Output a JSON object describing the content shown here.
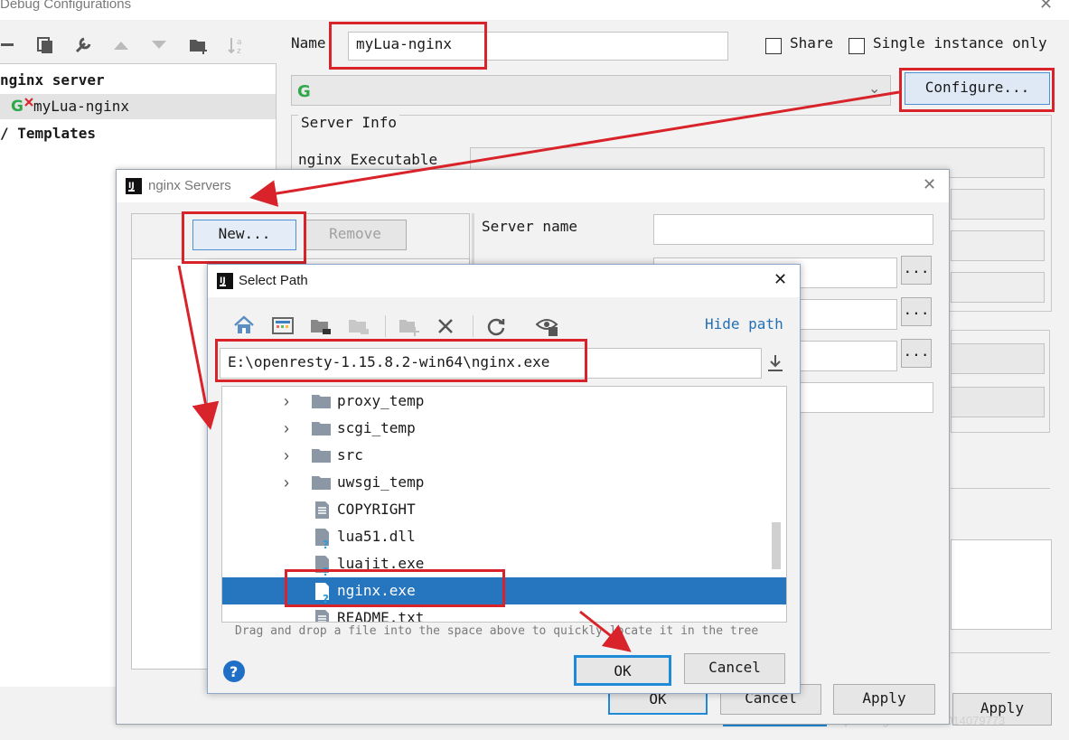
{
  "main": {
    "title": "Debug Configurations",
    "name_label": "Name",
    "name_value": "myLua-nginx",
    "share_label": "Share",
    "single_instance_label": "Single instance only",
    "configure_label": "Configure...",
    "server_info_label": "Server Info",
    "nginx_executable_label": "nginx Executable",
    "ok_label": "OK",
    "cancel_label": "Cancel",
    "apply_label": "Apply",
    "apply2_label": "Apply",
    "tree": [
      {
        "label": "nginx server"
      },
      {
        "label": "myLua-nginx"
      },
      {
        "label": "Templates"
      }
    ]
  },
  "servers_dialog": {
    "title": "nginx Servers",
    "new_label": "New...",
    "remove_label": "Remove",
    "server_name_label": "Server name",
    "ok_label": "OK",
    "cancel_label": "Cancel",
    "apply_label": "Apply"
  },
  "select_path": {
    "title": "Select Path",
    "hide_path_label": "Hide path",
    "path_value": "E:\\openresty-1.15.8.2-win64\\nginx.exe",
    "hint": "Drag and drop a file into the space above to quickly locate it in the tree",
    "ok_label": "OK",
    "cancel_label": "Cancel",
    "files": [
      {
        "name": "proxy_temp",
        "type": "folder"
      },
      {
        "name": "scgi_temp",
        "type": "folder"
      },
      {
        "name": "src",
        "type": "folder"
      },
      {
        "name": "uwsgi_temp",
        "type": "folder"
      },
      {
        "name": "COPYRIGHT",
        "type": "text"
      },
      {
        "name": "lua51.dll",
        "type": "unknown"
      },
      {
        "name": "luajit.exe",
        "type": "unknown"
      },
      {
        "name": "nginx.exe",
        "type": "unknown",
        "selected": true
      },
      {
        "name": "README.txt",
        "type": "text"
      }
    ]
  },
  "watermark": "https://blog.csdn.net/u014079773",
  "colors": {
    "highlight_red": "#d9232a",
    "selection_blue": "#2675bf",
    "link_blue": "#2470b3",
    "focus_blue": "#1f8ad7"
  }
}
